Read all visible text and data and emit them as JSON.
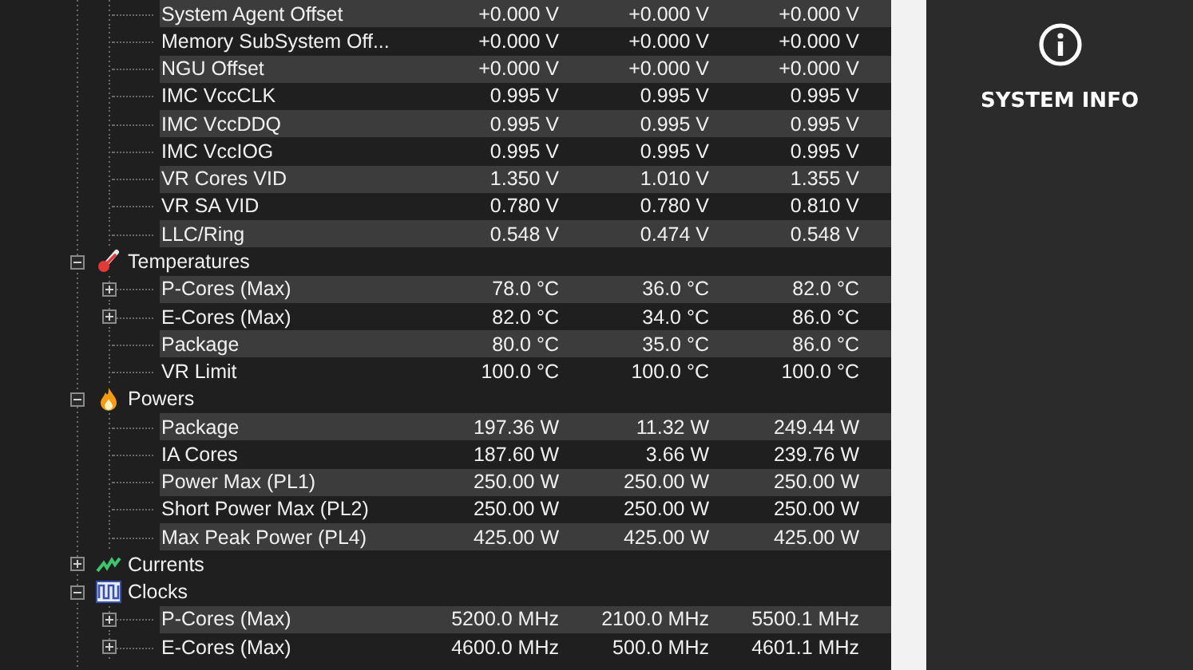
{
  "sensor_tree": {
    "groups": [
      {
        "rows": [
          {
            "label": "System Agent Offset",
            "expandable": false,
            "values": [
              "+0.000 V",
              "+0.000 V",
              "+0.000 V"
            ]
          },
          {
            "label": "Memory SubSystem Off...",
            "expandable": false,
            "values": [
              "+0.000 V",
              "+0.000 V",
              "+0.000 V"
            ]
          },
          {
            "label": "NGU Offset",
            "expandable": false,
            "values": [
              "+0.000 V",
              "+0.000 V",
              "+0.000 V"
            ]
          },
          {
            "label": "IMC VccCLK",
            "expandable": false,
            "values": [
              "0.995 V",
              "0.995 V",
              "0.995 V"
            ]
          },
          {
            "label": "IMC VccDDQ",
            "expandable": false,
            "values": [
              "0.995 V",
              "0.995 V",
              "0.995 V"
            ]
          },
          {
            "label": "IMC VccIOG",
            "expandable": false,
            "values": [
              "0.995 V",
              "0.995 V",
              "0.995 V"
            ]
          },
          {
            "label": "VR Cores VID",
            "expandable": false,
            "values": [
              "1.350 V",
              "1.010 V",
              "1.355 V"
            ]
          },
          {
            "label": "VR SA VID",
            "expandable": false,
            "values": [
              "0.780 V",
              "0.780 V",
              "0.810 V"
            ]
          },
          {
            "label": "LLC/Ring",
            "expandable": false,
            "values": [
              "0.548 V",
              "0.474 V",
              "0.548 V"
            ]
          }
        ]
      },
      {
        "name": "Temperatures",
        "kind": "thermometer",
        "expanded": true,
        "rows": [
          {
            "label": "P-Cores (Max)",
            "expandable": true,
            "values": [
              "78.0 °C",
              "36.0 °C",
              "82.0 °C"
            ]
          },
          {
            "label": "E-Cores (Max)",
            "expandable": true,
            "values": [
              "82.0 °C",
              "34.0 °C",
              "86.0 °C"
            ]
          },
          {
            "label": "Package",
            "expandable": false,
            "values": [
              "80.0 °C",
              "35.0 °C",
              "86.0 °C"
            ]
          },
          {
            "label": "VR Limit",
            "expandable": false,
            "values": [
              "100.0 °C",
              "100.0 °C",
              "100.0 °C"
            ]
          }
        ]
      },
      {
        "name": "Powers",
        "kind": "flame",
        "expanded": true,
        "rows": [
          {
            "label": "Package",
            "expandable": false,
            "values": [
              "197.36 W",
              "11.32 W",
              "249.44 W"
            ]
          },
          {
            "label": "IA Cores",
            "expandable": false,
            "values": [
              "187.60 W",
              "3.66 W",
              "239.76 W"
            ]
          },
          {
            "label": "Power Max (PL1)",
            "expandable": false,
            "values": [
              "250.00 W",
              "250.00 W",
              "250.00 W"
            ]
          },
          {
            "label": "Short Power Max (PL2)",
            "expandable": false,
            "values": [
              "250.00 W",
              "250.00 W",
              "250.00 W"
            ]
          },
          {
            "label": "Max Peak Power (PL4)",
            "expandable": false,
            "values": [
              "425.00 W",
              "425.00 W",
              "425.00 W"
            ]
          }
        ]
      },
      {
        "name": "Currents",
        "kind": "wave",
        "expanded": false
      },
      {
        "name": "Clocks",
        "kind": "pulse",
        "expanded": true,
        "rows": [
          {
            "label": "P-Cores (Max)",
            "expandable": true,
            "values": [
              "5200.0 MHz",
              "2100.0 MHz",
              "5500.1 MHz"
            ]
          },
          {
            "label": "E-Cores (Max)",
            "expandable": true,
            "values": [
              "4600.0 MHz",
              "500.0 MHz",
              "4601.1 MHz"
            ]
          }
        ]
      }
    ]
  },
  "side_panel": {
    "title": "SYSTEM INFO"
  }
}
